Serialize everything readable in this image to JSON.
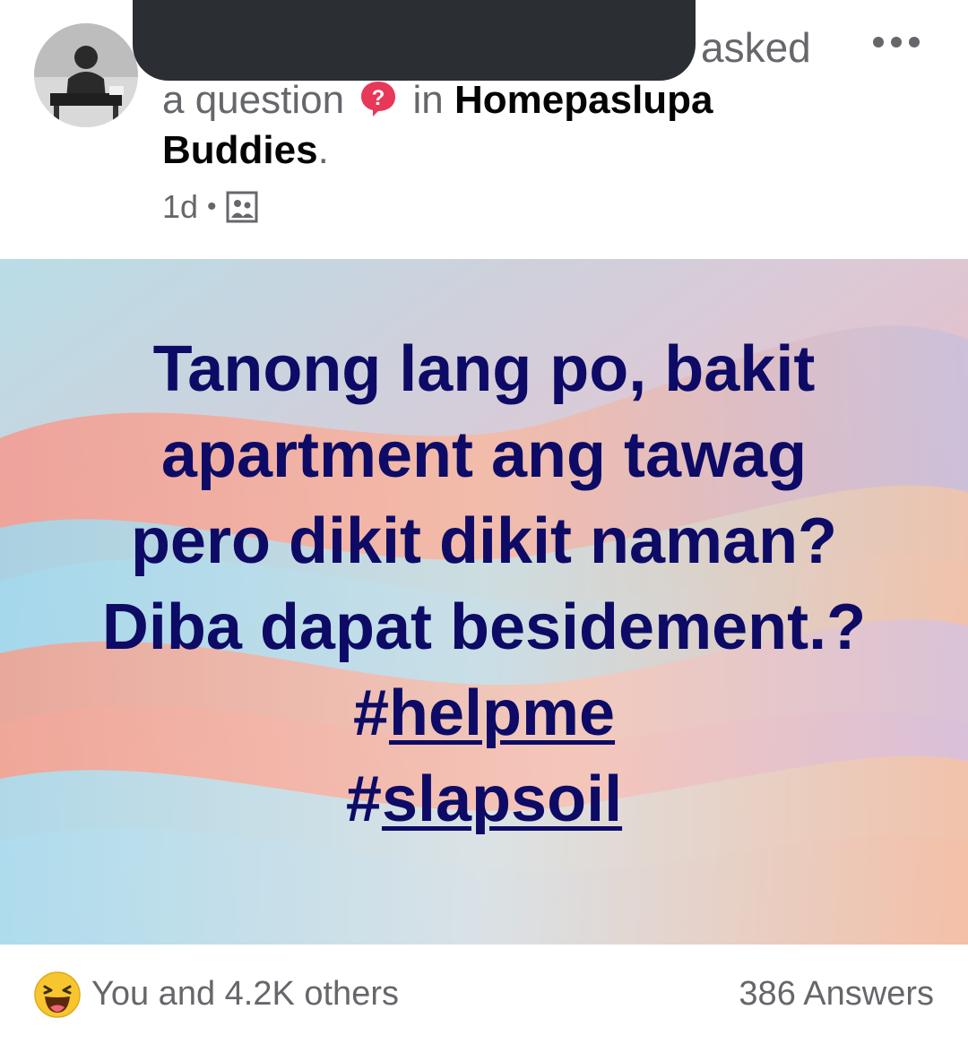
{
  "post": {
    "action_word": "asked",
    "headline_prefix": "a question",
    "headline_in": "in",
    "group_name": "Homepaslupa Buddies",
    "group_period": ".",
    "time_ago": "1d",
    "meta_separator": "•",
    "privacy_icon": "group-icon"
  },
  "content": {
    "lines": [
      "Tanong lang po, bakit",
      "apartment ang tawag",
      "pero dikit dikit naman?",
      "Diba dapat besidement.?"
    ],
    "hashtags": [
      {
        "hash": "#",
        "word": "helpme"
      },
      {
        "hash": "#",
        "word": "slapsoil"
      }
    ],
    "text_color": "#0d0b66"
  },
  "footer": {
    "reaction_icon": "haha-emoji-icon",
    "reactions_label": "You and 4.2K others",
    "answers_label": "386 Answers"
  },
  "colors": {
    "secondary_text": "#65676b",
    "primary_text": "#050505",
    "question_badge": "#e8385a"
  }
}
